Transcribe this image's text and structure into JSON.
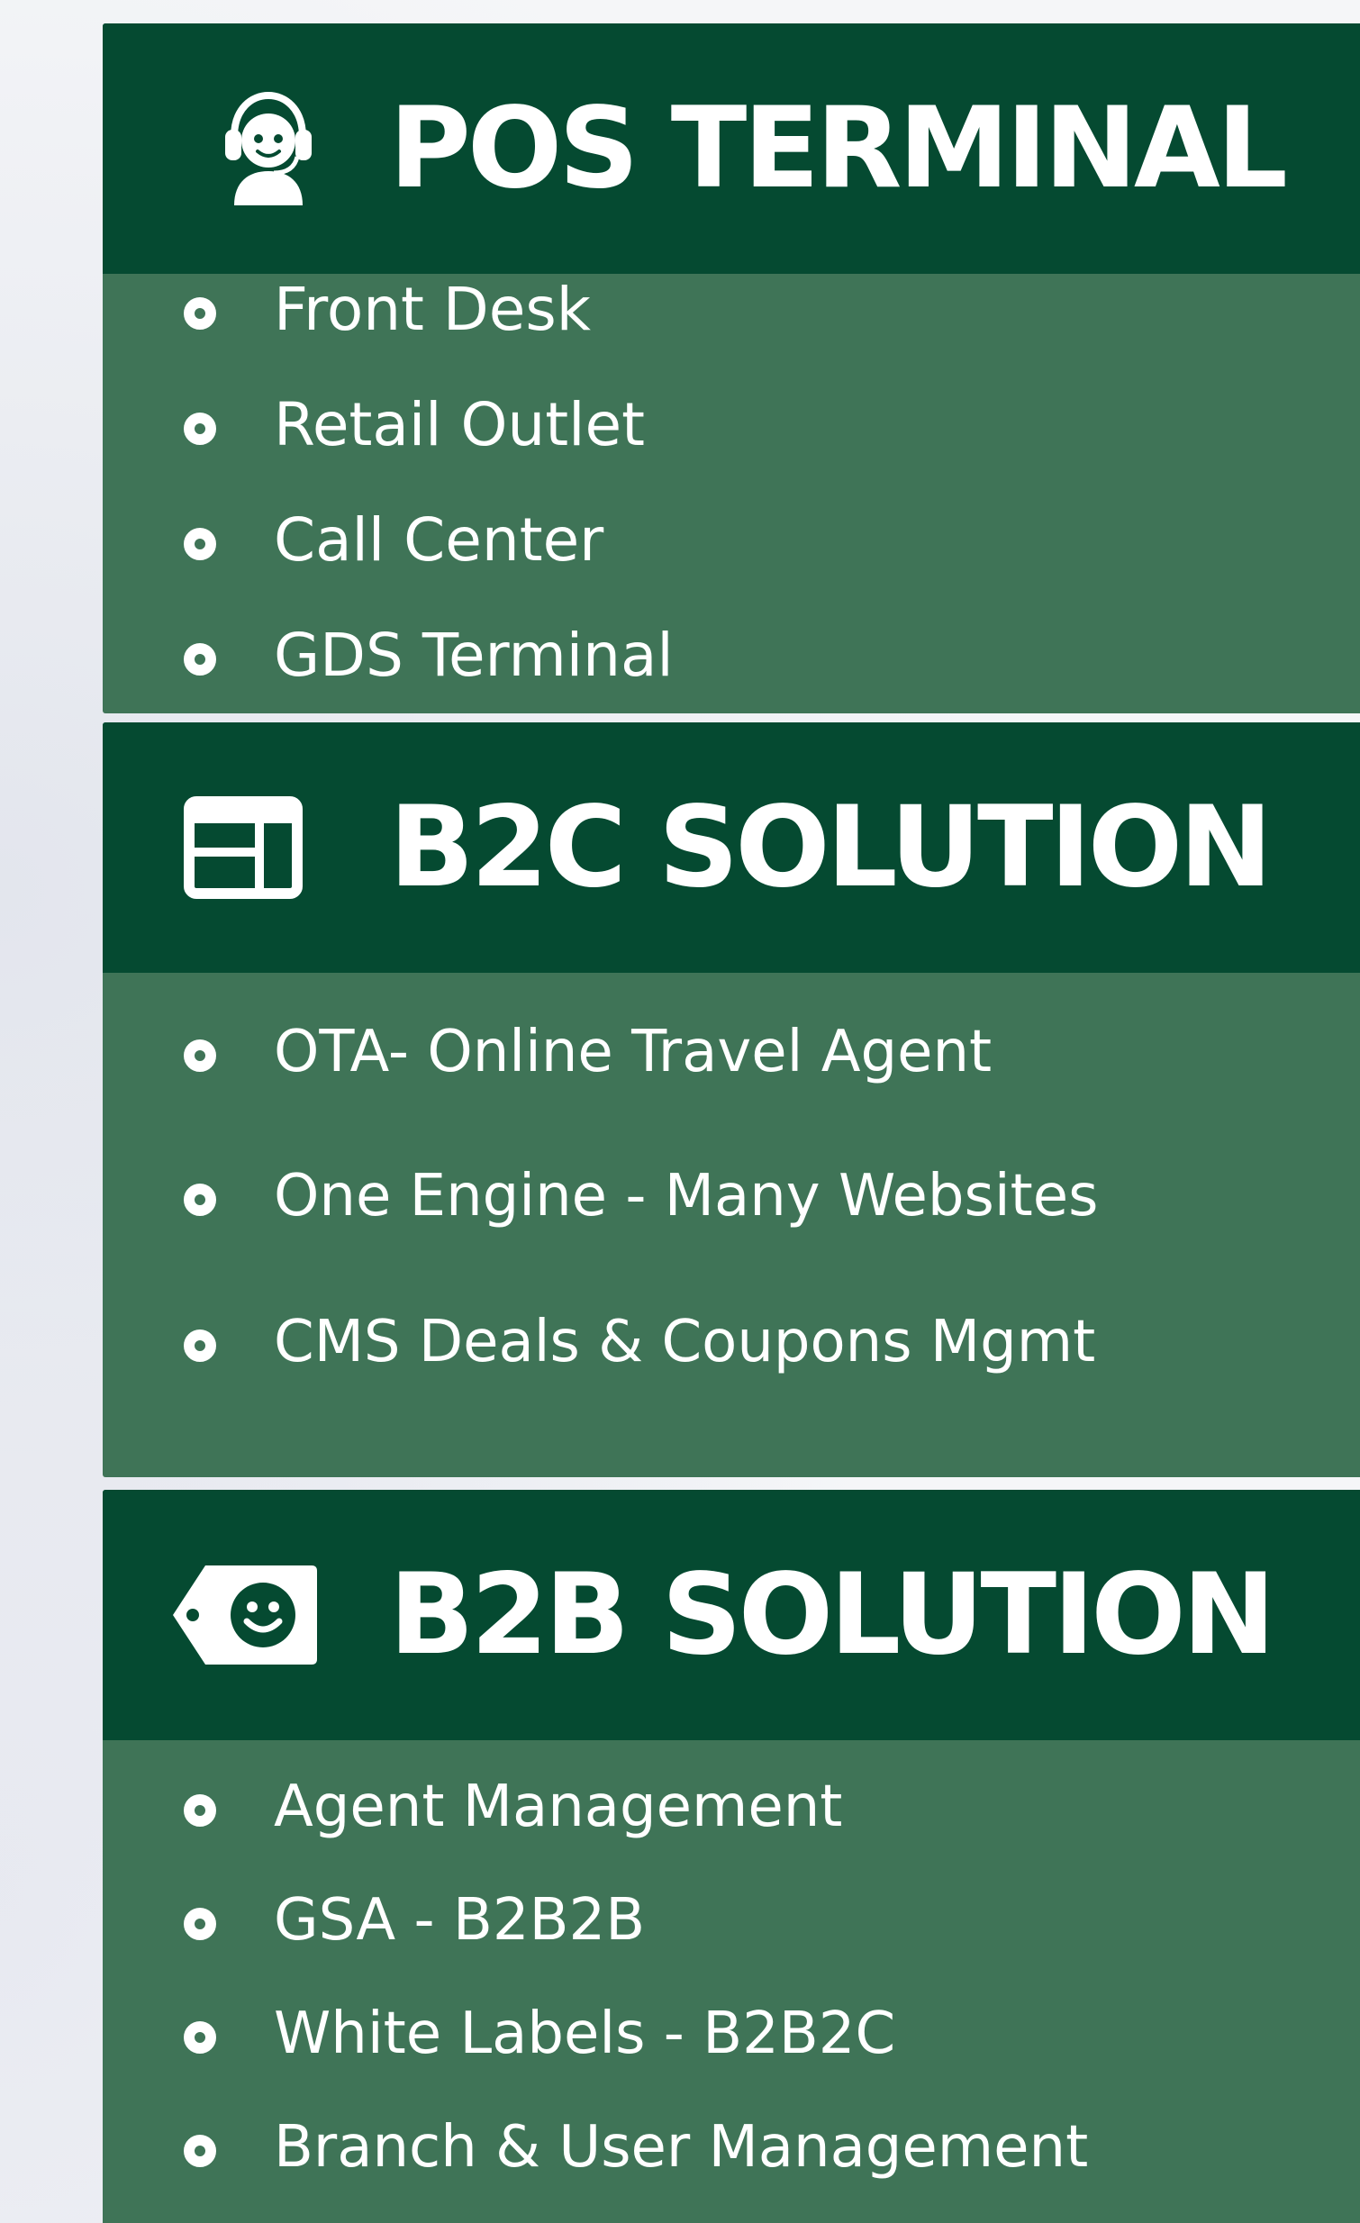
{
  "panels": {
    "pos": {
      "title": "POS TERMINAL",
      "icon": "headset-agent-icon",
      "items": [
        "Front Desk",
        "Retail Outlet",
        "Call Center",
        "GDS Terminal"
      ]
    },
    "b2c": {
      "title": "B2C SOLUTION",
      "icon": "browser-window-icon",
      "items": [
        "OTA- Online Travel Agent",
        "One Engine - Many Websites",
        "CMS Deals & Coupons Mgmt"
      ]
    },
    "b2b": {
      "title": "B2B SOLUTION",
      "icon": "smiley-tag-icon",
      "items": [
        "Agent Management",
        "GSA - B2B2B",
        "White Labels - B2B2C",
        "Branch & User Management"
      ]
    }
  },
  "colors": {
    "header_bg": "#054a31",
    "body_bg": "#3f7457",
    "text": "#ffffff"
  }
}
